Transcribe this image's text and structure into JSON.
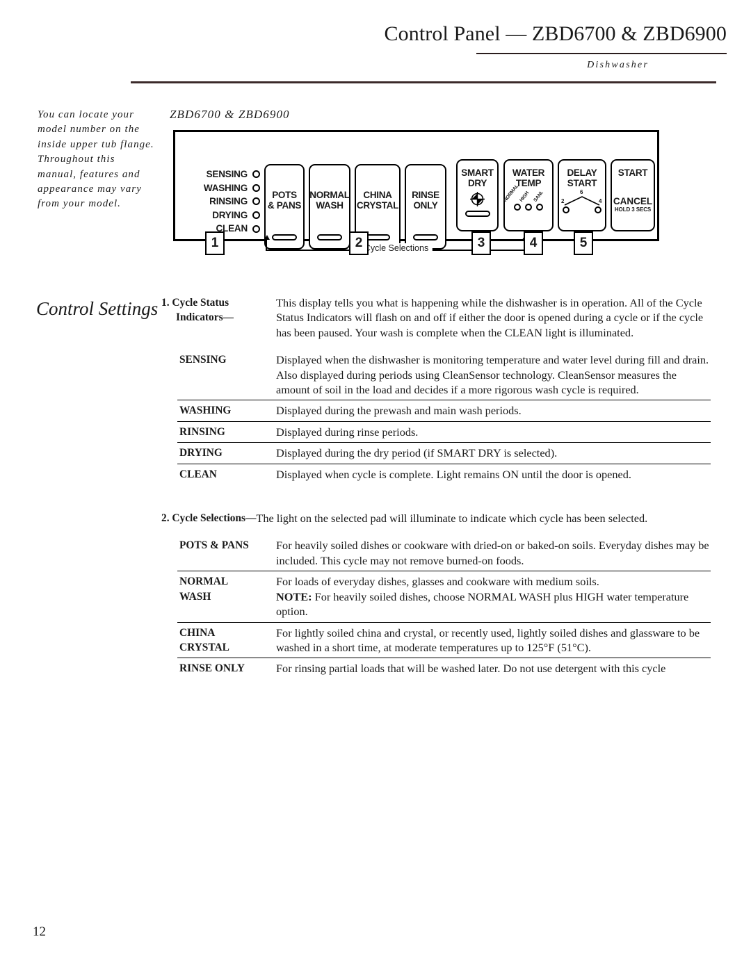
{
  "header": {
    "title": "Control Panel — ZBD6700 & ZBD6900",
    "subtitle": "Dishwasher"
  },
  "margin_note": "You can locate your model number on the inside upper tub flange. Throughout this manual, features and appearance may vary from your model.",
  "section_heading": "Control Settings",
  "diagram": {
    "caption": "ZBD6700 & ZBD6900",
    "status_indicators": [
      {
        "label": "SENSING"
      },
      {
        "label": "WASHING"
      },
      {
        "label": "RINSING"
      },
      {
        "label": "DRYING"
      },
      {
        "label": "CLEAN"
      }
    ],
    "cycle_pads": [
      {
        "line1": "POTS",
        "line2": "& PANS"
      },
      {
        "line1": "NORMAL",
        "line2": "WASH"
      },
      {
        "line1": "CHINA",
        "line2": "CRYSTAL"
      },
      {
        "line1": "RINSE",
        "line2": "ONLY"
      }
    ],
    "smart_dry": {
      "line1": "SMART",
      "line2": "DRY"
    },
    "water_temp": {
      "line1": "WATER",
      "line2": "TEMP",
      "options": [
        "NORMAL",
        "HIGH",
        "SANI."
      ]
    },
    "delay_start": {
      "line1": "DELAY",
      "line2": "START",
      "numbers": {
        "top": "6",
        "left": "2",
        "right": "4"
      }
    },
    "start": {
      "line1": "START",
      "cancel": "CANCEL",
      "cancel_sub": "HOLD 3 SECS"
    },
    "bracket_label": "Cycle Selections",
    "callouts": [
      "1",
      "2",
      "3",
      "4",
      "5"
    ]
  },
  "settings": {
    "item1": {
      "number": "1.",
      "term_line1": "Cycle Status",
      "term_line2": "Indicators—",
      "desc_p1": "This display tells you what is happening while the dishwasher is in operation. All of the Cycle Status Indicators will flash on and off if either the door is opened during a cycle or if the cycle has been paused. Your wash is complete when the CLEAN light is illuminated."
    },
    "sensing": {
      "term": "SENSING",
      "desc": "Displayed when the dishwasher is monitoring temperature and water level during fill and drain. Also displayed during periods using CleanSensor technology. CleanSensor measures the amount of soil in the load and decides if a more rigorous wash cycle is required."
    },
    "washing": {
      "term": "WASHING",
      "desc": "Displayed during the prewash and main wash periods."
    },
    "rinsing": {
      "term": "RINSING",
      "desc": "Displayed during rinse periods."
    },
    "drying": {
      "term": "DRYING",
      "desc": "Displayed during the dry period (if SMART DRY is selected)."
    },
    "clean": {
      "term": "CLEAN",
      "desc": "Displayed when cycle is complete. Light remains ON until the door is opened."
    },
    "item2": {
      "number": "2.",
      "term": "Cycle Selections—",
      "desc": "The light on the selected pad will illuminate to indicate which cycle has been selected."
    },
    "pots_pans": {
      "term": "POTS & PANS",
      "desc": "For heavily soiled dishes or cookware with dried-on or baked-on soils. Everyday dishes may be included. This cycle may not remove burned-on foods."
    },
    "normal_wash": {
      "term_line1": "NORMAL",
      "term_line2": "WASH",
      "desc_a": "For loads of everyday dishes, glasses and cookware with medium soils.",
      "desc_note_label": "NOTE:",
      "desc_b": " For heavily soiled dishes, choose NORMAL WASH plus HIGH water temperature option."
    },
    "china_crystal": {
      "term_line1": "CHINA",
      "term_line2": "CRYSTAL",
      "desc": "For lightly soiled china and crystal, or recently used, lightly soiled dishes and glassware to be washed in a short time, at moderate temperatures up to 125°F (51°C)."
    },
    "rinse_only": {
      "term": "RINSE ONLY",
      "desc": "For rinsing partial loads that will be washed later. Do not use detergent with this cycle"
    }
  },
  "footer": {
    "page_number": "12"
  }
}
